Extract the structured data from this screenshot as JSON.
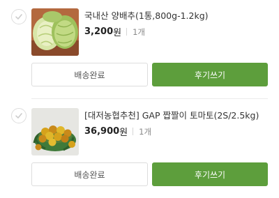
{
  "orders": [
    {
      "product_name": "국내산 양배추(1통,800g-1.2kg)",
      "price": "3,200",
      "currency": "원",
      "quantity": "1개",
      "status_label": "배송완료",
      "review_label": "후기쓰기",
      "thumbnail_icon": "cabbage-image"
    },
    {
      "product_name": "[대저농협추천] GAP 짭짤이 토마토(2S/2.5kg)",
      "price": "36,900",
      "currency": "원",
      "quantity": "1개",
      "status_label": "배송완료",
      "review_label": "후기쓰기",
      "thumbnail_icon": "tomato-bowl-image"
    }
  ],
  "colors": {
    "accent": "#5d9e3c",
    "border": "#dddddd",
    "checkbox_check": "#cccccc"
  }
}
